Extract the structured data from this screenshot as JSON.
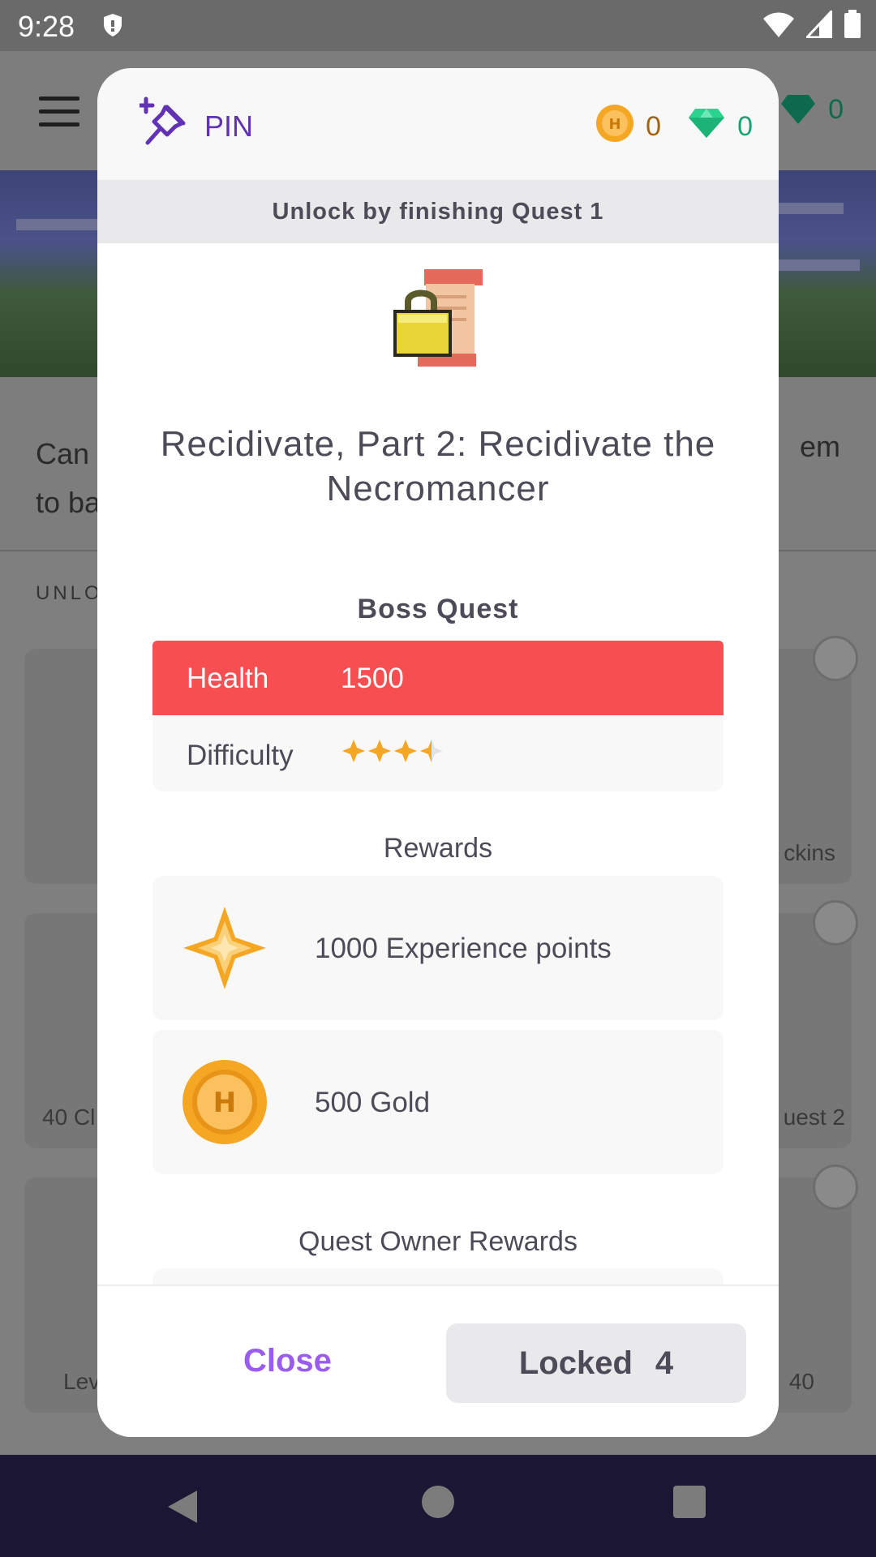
{
  "status_bar": {
    "time": "9:28"
  },
  "background": {
    "description_left_line1": "Can",
    "description_left_line2": "to ba",
    "description_right": "em",
    "list_label": "UNLO",
    "gem_count": "0",
    "card_texts": [
      "ckins",
      "40 Cl",
      "uest 2",
      "Lev",
      "40"
    ]
  },
  "dialog": {
    "pin_label": "PIN",
    "gold_count": "0",
    "gem_count": "0",
    "unlock_text": "Unlock by finishing Quest 1",
    "title": "Recidivate, Part 2: Recidivate the Necromancer",
    "boss_label": "Boss Quest",
    "health_label": "Health",
    "health_value": "1500",
    "difficulty_label": "Difficulty",
    "difficulty_stars": 3.5,
    "difficulty_max": 4,
    "rewards_label": "Rewards",
    "rewards": [
      {
        "icon": "experience-star-icon",
        "text": "1000 Experience points"
      },
      {
        "icon": "gold-coin-icon",
        "text": "500 Gold"
      }
    ],
    "owner_rewards_label": "Quest Owner Rewards",
    "close_label": "Close",
    "locked_label": "Locked",
    "locked_count": "4"
  },
  "colors": {
    "accent_purple": "#6133b4",
    "close_purple": "#9a5cf0",
    "health_red": "#f74e52",
    "gold": "#a6620c",
    "gem": "#1ca372",
    "text": "#4e4a57"
  }
}
